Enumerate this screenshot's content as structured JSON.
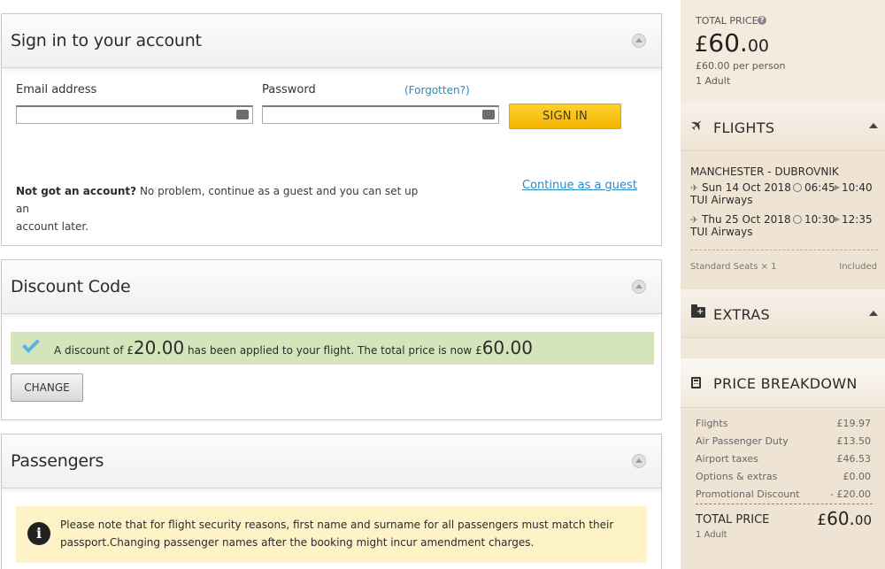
{
  "signin": {
    "title": "Sign in to your account",
    "email_label": "Email address",
    "email_value": "",
    "password_label": "Password",
    "password_value": "",
    "forgotten_link": "(Forgotten?)",
    "signin_button": "SIGN IN",
    "no_account_bold": "Not got an account?",
    "no_account_text": " No problem, continue as a guest and you can set up an",
    "no_account_text2": "account later.",
    "guest_link": "Continue as a guest"
  },
  "discount": {
    "title": "Discount Code",
    "msg_pre": "A discount of ",
    "currency1": "£",
    "amount": "20.00",
    "msg_mid": " has been applied to your flight. The total price is now ",
    "currency2": "£",
    "new_total": "60.00",
    "change_button": "CHANGE",
    "colors": {
      "success_bg": "#d4e4bb",
      "check": "#5bb1e0"
    }
  },
  "passengers": {
    "title": "Passengers",
    "notice_line1": "Please note that for flight security reasons, first name and surname for all passengers must match their",
    "notice_line2": "passport.Changing passenger names after the booking might incur amendment charges.",
    "notice_icon": "info-icon",
    "colors": {
      "notice_bg": "#fdf3c6"
    }
  },
  "sidebar": {
    "total_label": "TOTAL PRICE",
    "help_icon": "question-icon",
    "total_currency": "£",
    "total_int": "60.",
    "total_dec": "00",
    "per_person": "£60.00 per person",
    "adults": "1 Adult",
    "flights": {
      "title": "FLIGHTS",
      "icon": "plane-icon",
      "route": "MANCHESTER - DUBROVNIK",
      "legs": [
        {
          "date": "Sun 14 Oct 2018",
          "depart": "06:45",
          "arrive": "10:40",
          "airline": "TUI Airways"
        },
        {
          "date": "Thu 25 Oct 2018",
          "depart": "10:30",
          "arrive": "12:35",
          "airline": "TUI Airways"
        }
      ],
      "seats_label": "Standard Seats × 1",
      "seats_value": "Included"
    },
    "extras": {
      "title": "EXTRAS",
      "icon": "folder-plus-icon"
    },
    "breakdown": {
      "title": "PRICE BREAKDOWN",
      "icon": "calculator-icon",
      "rows": [
        {
          "label": "Flights",
          "value": "£19.97"
        },
        {
          "label": "Air Passenger Duty",
          "value": "£13.50"
        },
        {
          "label": "Airport taxes",
          "value": "£46.53"
        },
        {
          "label": "Options & extras",
          "value": "£0.00"
        },
        {
          "label": "Promotional Discount",
          "value": "- £20.00"
        }
      ],
      "total_label": "TOTAL PRICE",
      "total_currency": "£",
      "total_int": "60.",
      "total_dec": "00",
      "total_sub": "1 Adult"
    },
    "colors": {
      "bg": "#f2e8da",
      "accent": "#f5b400"
    }
  }
}
